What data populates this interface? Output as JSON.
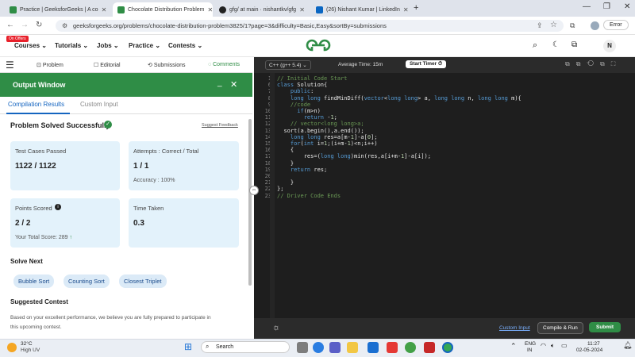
{
  "browser": {
    "tabs": [
      {
        "label": "Practice | GeeksforGeeks | A co",
        "active": false
      },
      {
        "label": "Chocolate Distribution Problem",
        "active": true
      },
      {
        "label": "gfg/ at main · nishantkv/gfg",
        "active": false
      },
      {
        "label": "(26) Nishant Kumar | LinkedIn",
        "active": false
      }
    ],
    "url": "geeksforgeeks.org/problems/chocolate-distribution-problem3825/1?page=3&difficulty=Basic,Easy&sortBy=submissions",
    "profile_label": "Error"
  },
  "site_nav": {
    "items": [
      "Courses",
      "Tutorials",
      "Jobs",
      "Practice",
      "Contests"
    ],
    "badge": "On Offers",
    "logo": "GfG",
    "avatar": "N"
  },
  "problem_tabs": [
    "Problem",
    "Editorial",
    "Submissions",
    "Comments"
  ],
  "editor_bar": {
    "language": "C++ (g++ 5.4)",
    "average_time": "Average Time: 15m",
    "start_timer": "Start Timer"
  },
  "code_lines": [
    {
      "num": "1",
      "text": "// Initial Code Start"
    },
    {
      "num": "6",
      "text": "class Solution{"
    },
    {
      "num": "7",
      "text": "    public:"
    },
    {
      "num": "8",
      "text": "    long long findMinDiff(vector<long long> a, long long n, long long m){"
    },
    {
      "num": "9",
      "text": "    //code"
    },
    {
      "num": "10",
      "text": "      if(m>n)"
    },
    {
      "num": "11",
      "text": "        return -1;"
    },
    {
      "num": "12",
      "text": "    // vector<long long>a;"
    },
    {
      "num": "13",
      "text": "  sort(a.begin(),a.end());"
    },
    {
      "num": "14",
      "text": "    long long res=a[m-1]-a[0];"
    },
    {
      "num": "15",
      "text": "    for(int i=1;(i+m-1)<n;i++)"
    },
    {
      "num": "16",
      "text": "    {"
    },
    {
      "num": "17",
      "text": "        res=(long long)min(res,a[i+m-1]-a[i]);"
    },
    {
      "num": "18",
      "text": "    }"
    },
    {
      "num": "19",
      "text": "    return res;"
    },
    {
      "num": "20",
      "text": ""
    },
    {
      "num": "21",
      "text": "    }"
    },
    {
      "num": "22",
      "text": "};"
    },
    {
      "num": "23",
      "text": "// Driver Code Ends"
    }
  ],
  "editor_footer": {
    "custom_input": "Custom Input",
    "compile_run": "Compile & Run",
    "submit": "Submit"
  },
  "output": {
    "title": "Output Window",
    "tabs": [
      "Compilation Results",
      "Custom Input"
    ],
    "status": "Problem Solved Successfully",
    "suggest": "Suggest Feedback",
    "test_cases_label": "Test Cases Passed",
    "test_cases_value": "1122 / 1122",
    "attempts_label": "Attempts : Correct / Total",
    "attempts_value": "1 / 1",
    "accuracy": "Accuracy : 100%",
    "points_label": "Points Scored",
    "points_value": "2 / 2",
    "total_score": "Your Total Score: 289",
    "time_label": "Time Taken",
    "time_value": "0.3",
    "solve_next": "Solve Next",
    "next_problems": [
      "Bubble Sort",
      "Counting Sort",
      "Closest Triplet"
    ],
    "suggested_contest": "Suggested Contest",
    "contest_text_1": "Based on your excellent performance, we believe you are fully prepared to participate in",
    "contest_text_2": "this upcoming contest."
  },
  "taskbar": {
    "weather_temp": "32°C",
    "weather_desc": "High UV",
    "search": "Search",
    "lang": "ENG",
    "lang2": "IN",
    "time": "11:27",
    "date": "02-05-2024"
  }
}
